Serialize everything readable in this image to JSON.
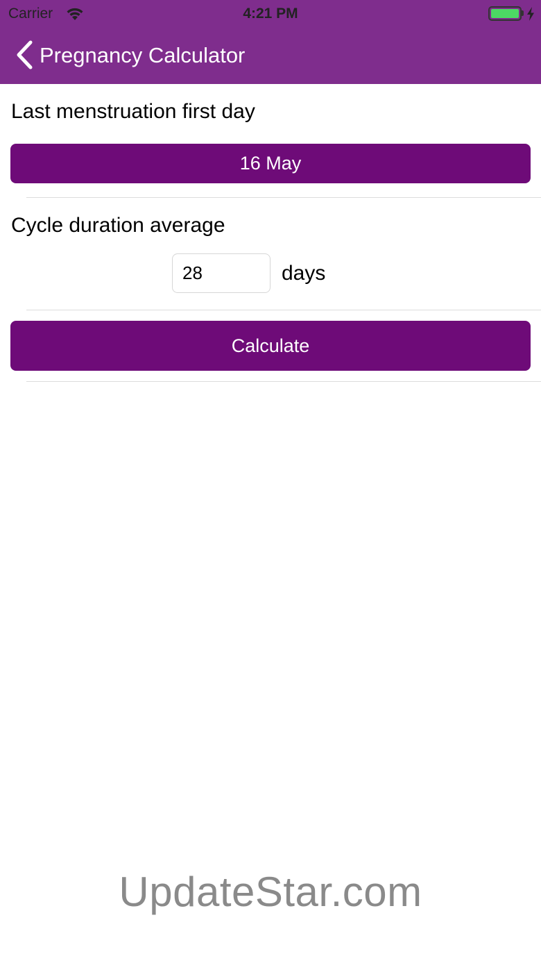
{
  "status_bar": {
    "carrier": "Carrier",
    "time": "4:21 PM",
    "wifi_icon": "wifi-icon",
    "battery_icon": "battery-icon",
    "battery_level": 1.0,
    "charging_icon": "charging-bolt-icon"
  },
  "nav_bar": {
    "back_icon": "chevron-left-icon",
    "title": "Pregnancy Calculator"
  },
  "form": {
    "menstruation_label": "Last menstruation first day",
    "date_value": "16 May",
    "cycle_label": "Cycle duration average",
    "cycle_value": "28",
    "cycle_unit": "days",
    "calculate_label": "Calculate"
  },
  "watermark": "UpdateStar.com",
  "colors": {
    "nav_background": "#7f2d8d",
    "button_background": "#6e0b78",
    "button_text": "#ffffff",
    "battery_fill": "#4cd964",
    "watermark": "#8a8a8a"
  }
}
